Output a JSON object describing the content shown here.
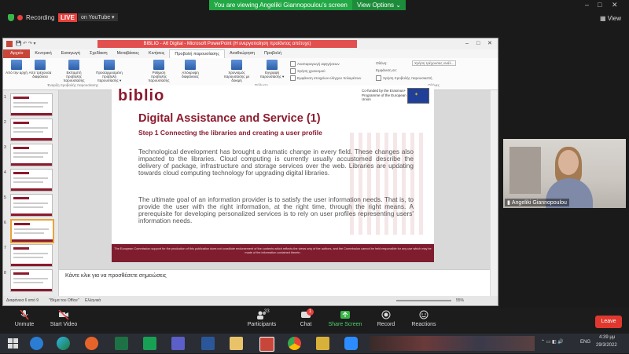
{
  "zoom": {
    "share_banner": "You are viewing Angeliki Giannopoulou's screen",
    "view_options": "View Options ⌄",
    "recording": "Recording",
    "live": "LIVE",
    "youtube": "on YouTube ▾",
    "view": "View",
    "toolbar": [
      {
        "label": "Unmute",
        "icon": "microphone-muted-icon"
      },
      {
        "label": "Start Video",
        "icon": "video-off-icon"
      },
      {
        "label": "Participants",
        "icon": "participants-icon",
        "count": "33"
      },
      {
        "label": "Chat",
        "icon": "chat-icon",
        "badge": "1"
      },
      {
        "label": "Share Screen",
        "icon": "share-screen-icon"
      },
      {
        "label": "Record",
        "icon": "record-icon"
      },
      {
        "label": "Reactions",
        "icon": "reactions-icon"
      }
    ],
    "leave": "Leave",
    "participant_name": "Angeliki Giannopoulou"
  },
  "ppt": {
    "title": "BIBLIO - A6 Digital - Microsoft PowerPoint (Η ενεργοποίηση προϊόντος απέτυχε)",
    "tabs": [
      "Αρχείο",
      "Κεντρική",
      "Εισαγωγή",
      "Σχεδίαση",
      "Μεταβάσεις",
      "Κινήσεις",
      "Προβολή παρουσίασης",
      "Αναθεώρηση",
      "Προβολή"
    ],
    "active_tab": "Προβολή παρουσίασης",
    "ribbon_buttons": [
      "Από την αρχή",
      "Από τρέχουσα διαφάνεια",
      "Εκπομπή προβολής παρουσίασης",
      "Προσαρμοσμένη προβολή παρουσίασης ▾",
      "Ρύθμιση προβολής παρουσίασης",
      "Απόκρυψη διαφάνειας",
      "Χρονισμός παρουσίασης με δοκιμή",
      "Εγγραφή παρουσίασης ▾"
    ],
    "ribbon_checks": [
      "Αναπαραγωγή αφηγήσεων",
      "Χρήση χρονισμού",
      "Εμφάνιση στοιχείων ελέγχου πολυμέσων"
    ],
    "monitor": {
      "label1": "Οθόνη:",
      "value1": "Χρήση τρέχουσας ανάλ...",
      "label2": "Εμφάνιση σε:",
      "check": "Χρήση προβολής παρουσιαστή"
    },
    "group_labels": [
      "Έναρξη προβολής παρουσίασης",
      "Ρύθμιση",
      "Οθόνες"
    ],
    "thumbnails": [
      "1",
      "2",
      "3",
      "4",
      "5",
      "6",
      "7",
      "8"
    ],
    "notes_placeholder": "Κάντε κλικ για να προσθέσετε σημειώσεις",
    "status": {
      "slide": "Διαφάνεια 6 από 9",
      "theme": "\"Θέμα του Office\"",
      "lang": "Ελληνικά",
      "zoom": "55%"
    }
  },
  "slide": {
    "logo": "biblio",
    "eu_text": "Co-funded by the Erasmus+ Programme of the European Union",
    "title": "Digital Assistance and Service (1)",
    "subtitle": "Step 1 Connecting the libraries and creating a user profile",
    "para1": "Technological development has brought a dramatic change in every field. These changes also impacted to the libraries. Cloud computing is currently usually accustomed describe the delivery of package, infrastructure and storage services over the web. Libraries are updating towards cloud computing technology for upgrading digital libraries.",
    "para2": "The ultimate goal of an information provider is to satisfy the user information needs. That is, to provide the user with the right information, at the right time, through the right means. A prerequisite for developing personalized services is to rely on user profiles representing users' information needs.",
    "footer": "The European Commission support for the production of this publication does not constitute endorsement of the contents which reflects the views only of the authors, and the Commission cannot be held responsible for any use which may be made of the information contained therein."
  },
  "taskbar": {
    "lang": "ENG",
    "time": "4:39 μμ",
    "date": "29/3/2022"
  }
}
